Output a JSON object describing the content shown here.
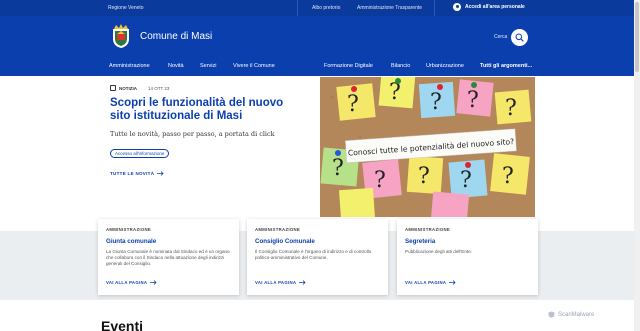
{
  "topbar": {
    "region": "Regione Veneto",
    "links": [
      "Albo pretorio",
      "Amministrazione Trasparente"
    ],
    "login": "Accedi all'area personale"
  },
  "header": {
    "title": "Comune di Masi",
    "search_label": "Cerca"
  },
  "nav": {
    "items": [
      "Amministrazione",
      "Novità",
      "Servizi",
      "Vivere il Comune"
    ],
    "secondary": [
      "Formazione Digitale",
      "Bilancio",
      "Urbanizzazione"
    ],
    "all_topics": "Tutti gli argomenti..."
  },
  "hero": {
    "category": "NOTIZIA",
    "date": "14 OTT 23",
    "title": "Scopri le funzionalità del nuovo sito istituzionale di Masi",
    "subtitle": "Tutte le novità, passo per passo, a portata di click",
    "tag": "Accesso all'informazione",
    "all_news": "TUTTE LE NOVITÀ",
    "image_text": "Conosci tutte le potenzialità del nuovo sito?"
  },
  "cards": [
    {
      "category": "AMMINISTRAZIONE",
      "title": "Giunta comunale",
      "description": "La Giunta Comunale è nominata dal Sindaco ed è un organo che collabora con il Sindaco nella attuazione degli indirizzi generali del Consiglio.",
      "link": "VAI ALLA PAGINA"
    },
    {
      "category": "AMMINISTRAZIONE",
      "title": "Consiglio Comunale",
      "description": "Il Consiglio Comunale è l'organo di indirizzo e di controllo politico-amministrativo del Comune.",
      "link": "VAI ALLA PAGINA"
    },
    {
      "category": "AMMINISTRAZIONE",
      "title": "Segreteria",
      "description": "Pubblicazione degli atti dell'Ente.",
      "link": "VAI ALLA PAGINA"
    }
  ],
  "events_heading": "Eventi",
  "watermark": "ScanMalware",
  "colors": {
    "primary": "#0b3fae",
    "topbar": "#0a3a9c",
    "cards_background": "#ebeef0"
  }
}
